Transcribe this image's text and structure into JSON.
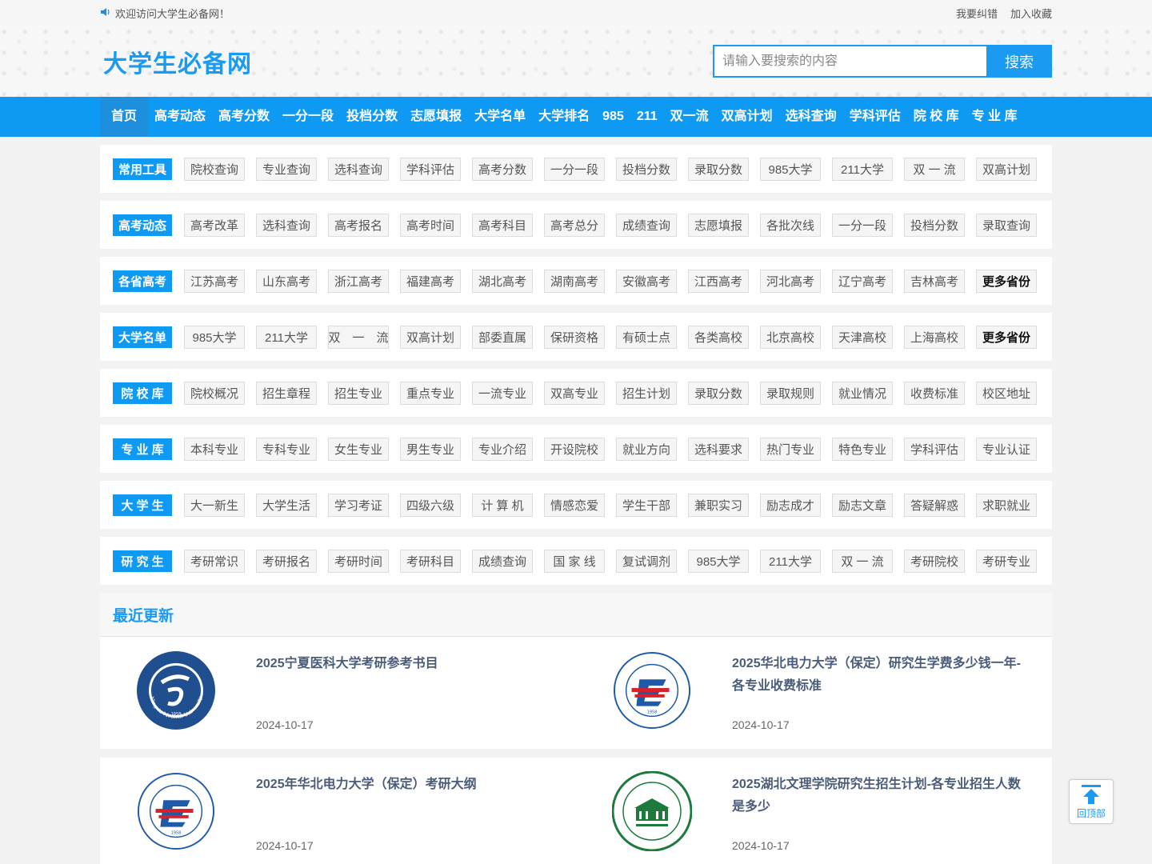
{
  "topbar": {
    "welcome": "欢迎访问大学生必备网！",
    "report": "我要纠错",
    "favorite": "加入收藏"
  },
  "header": {
    "logo": "大学生必备网",
    "search_placeholder": "请输入要搜索的内容",
    "search_button": "搜索"
  },
  "nav": [
    "首页",
    "高考动态",
    "高考分数",
    "一分一段",
    "投档分数",
    "志愿填报",
    "大学名单",
    "大学排名",
    "985",
    "211",
    "双一流",
    "双高计划",
    "选科查询",
    "学科评估",
    "院 校 库",
    "专 业 库"
  ],
  "categories": [
    {
      "label": "常用工具",
      "items": [
        "院校查询",
        "专业查询",
        "选科查询",
        "学科评估",
        "高考分数",
        "一分一段",
        "投档分数",
        "录取分数",
        "985大学",
        "211大学",
        "双 一 流",
        "双高计划"
      ]
    },
    {
      "label": "高考动态",
      "items": [
        "高考改革",
        "选科查询",
        "高考报名",
        "高考时间",
        "高考科目",
        "高考总分",
        "成绩查询",
        "志愿填报",
        "各批次线",
        "一分一段",
        "投档分数",
        "录取查询"
      ]
    },
    {
      "label": "各省高考",
      "items": [
        "江苏高考",
        "山东高考",
        "浙江高考",
        "福建高考",
        "湖北高考",
        "湖南高考",
        "安徽高考",
        "江西高考",
        "河北高考",
        "辽宁高考",
        "吉林高考",
        "更多省份"
      ]
    },
    {
      "label": "大学名单",
      "items": [
        "985大学",
        "211大学",
        "双　一　流",
        "双高计划",
        "部委直属",
        "保研资格",
        "有硕士点",
        "各类高校",
        "北京高校",
        "天津高校",
        "上海高校",
        "更多省份"
      ]
    },
    {
      "label": "院 校 库",
      "items": [
        "院校概况",
        "招生章程",
        "招生专业",
        "重点专业",
        "一流专业",
        "双高专业",
        "招生计划",
        "录取分数",
        "录取规则",
        "就业情况",
        "收费标准",
        "校区地址"
      ]
    },
    {
      "label": "专 业 库",
      "items": [
        "本科专业",
        "专科专业",
        "女生专业",
        "男生专业",
        "专业介绍",
        "开设院校",
        "就业方向",
        "选科要求",
        "热门专业",
        "特色专业",
        "学科评估",
        "专业认证"
      ]
    },
    {
      "label": "大 学 生",
      "items": [
        "大一新生",
        "大学生活",
        "学习考证",
        "四级六级",
        "计 算 机",
        "情感恋爱",
        "学生干部",
        "兼职实习",
        "励志成才",
        "励志文章",
        "答疑解惑",
        "求职就业"
      ]
    },
    {
      "label": "研 究 生",
      "items": [
        "考研常识",
        "考研报名",
        "考研时间",
        "考研科目",
        "成绩查询",
        "国 家 线",
        "复试调剂",
        "985大学",
        "211大学",
        "双 一 流",
        "考研院校",
        "考研专业"
      ]
    }
  ],
  "recent": {
    "heading": "最近更新",
    "articles": [
      {
        "title": "2025宁夏医科大学考研参考书目",
        "date": "2024-10-17",
        "logo": "ningxia-medical-logo",
        "logo_text": "Ningxia Medical University",
        "logo_year": "1958"
      },
      {
        "title": "2025华北电力大学（保定）研究生学费多少钱一年-各专业收费标准",
        "date": "2024-10-17",
        "logo": "ncepu-logo",
        "logo_text": "NORTH CHINA ELECTRIC POWER UNIVERSITY",
        "logo_year": "1958"
      },
      {
        "title": "2025年华北电力大学（保定）考研大纲",
        "date": "2024-10-17",
        "logo": "ncepu-logo",
        "logo_text": "NORTH CHINA ELECTRIC POWER UNIVERSITY",
        "logo_year": "1958"
      },
      {
        "title": "2025湖北文理学院研究生招生计划-各专业招生人数是多少",
        "date": "2024-10-17",
        "logo": "hubei-arts-logo",
        "logo_text": "HUBEI UNIVERSITY OF ARTS AND SCIENCE"
      }
    ]
  },
  "totop": {
    "label": "回顶部"
  },
  "colors": {
    "primary": "#0e9af2",
    "logo": "#1a9af0",
    "title": "#4a5c7a",
    "ncepu_red": "#d6202a",
    "ncepu_blue": "#1e5aa8",
    "hubei_green": "#1e7a3c"
  }
}
